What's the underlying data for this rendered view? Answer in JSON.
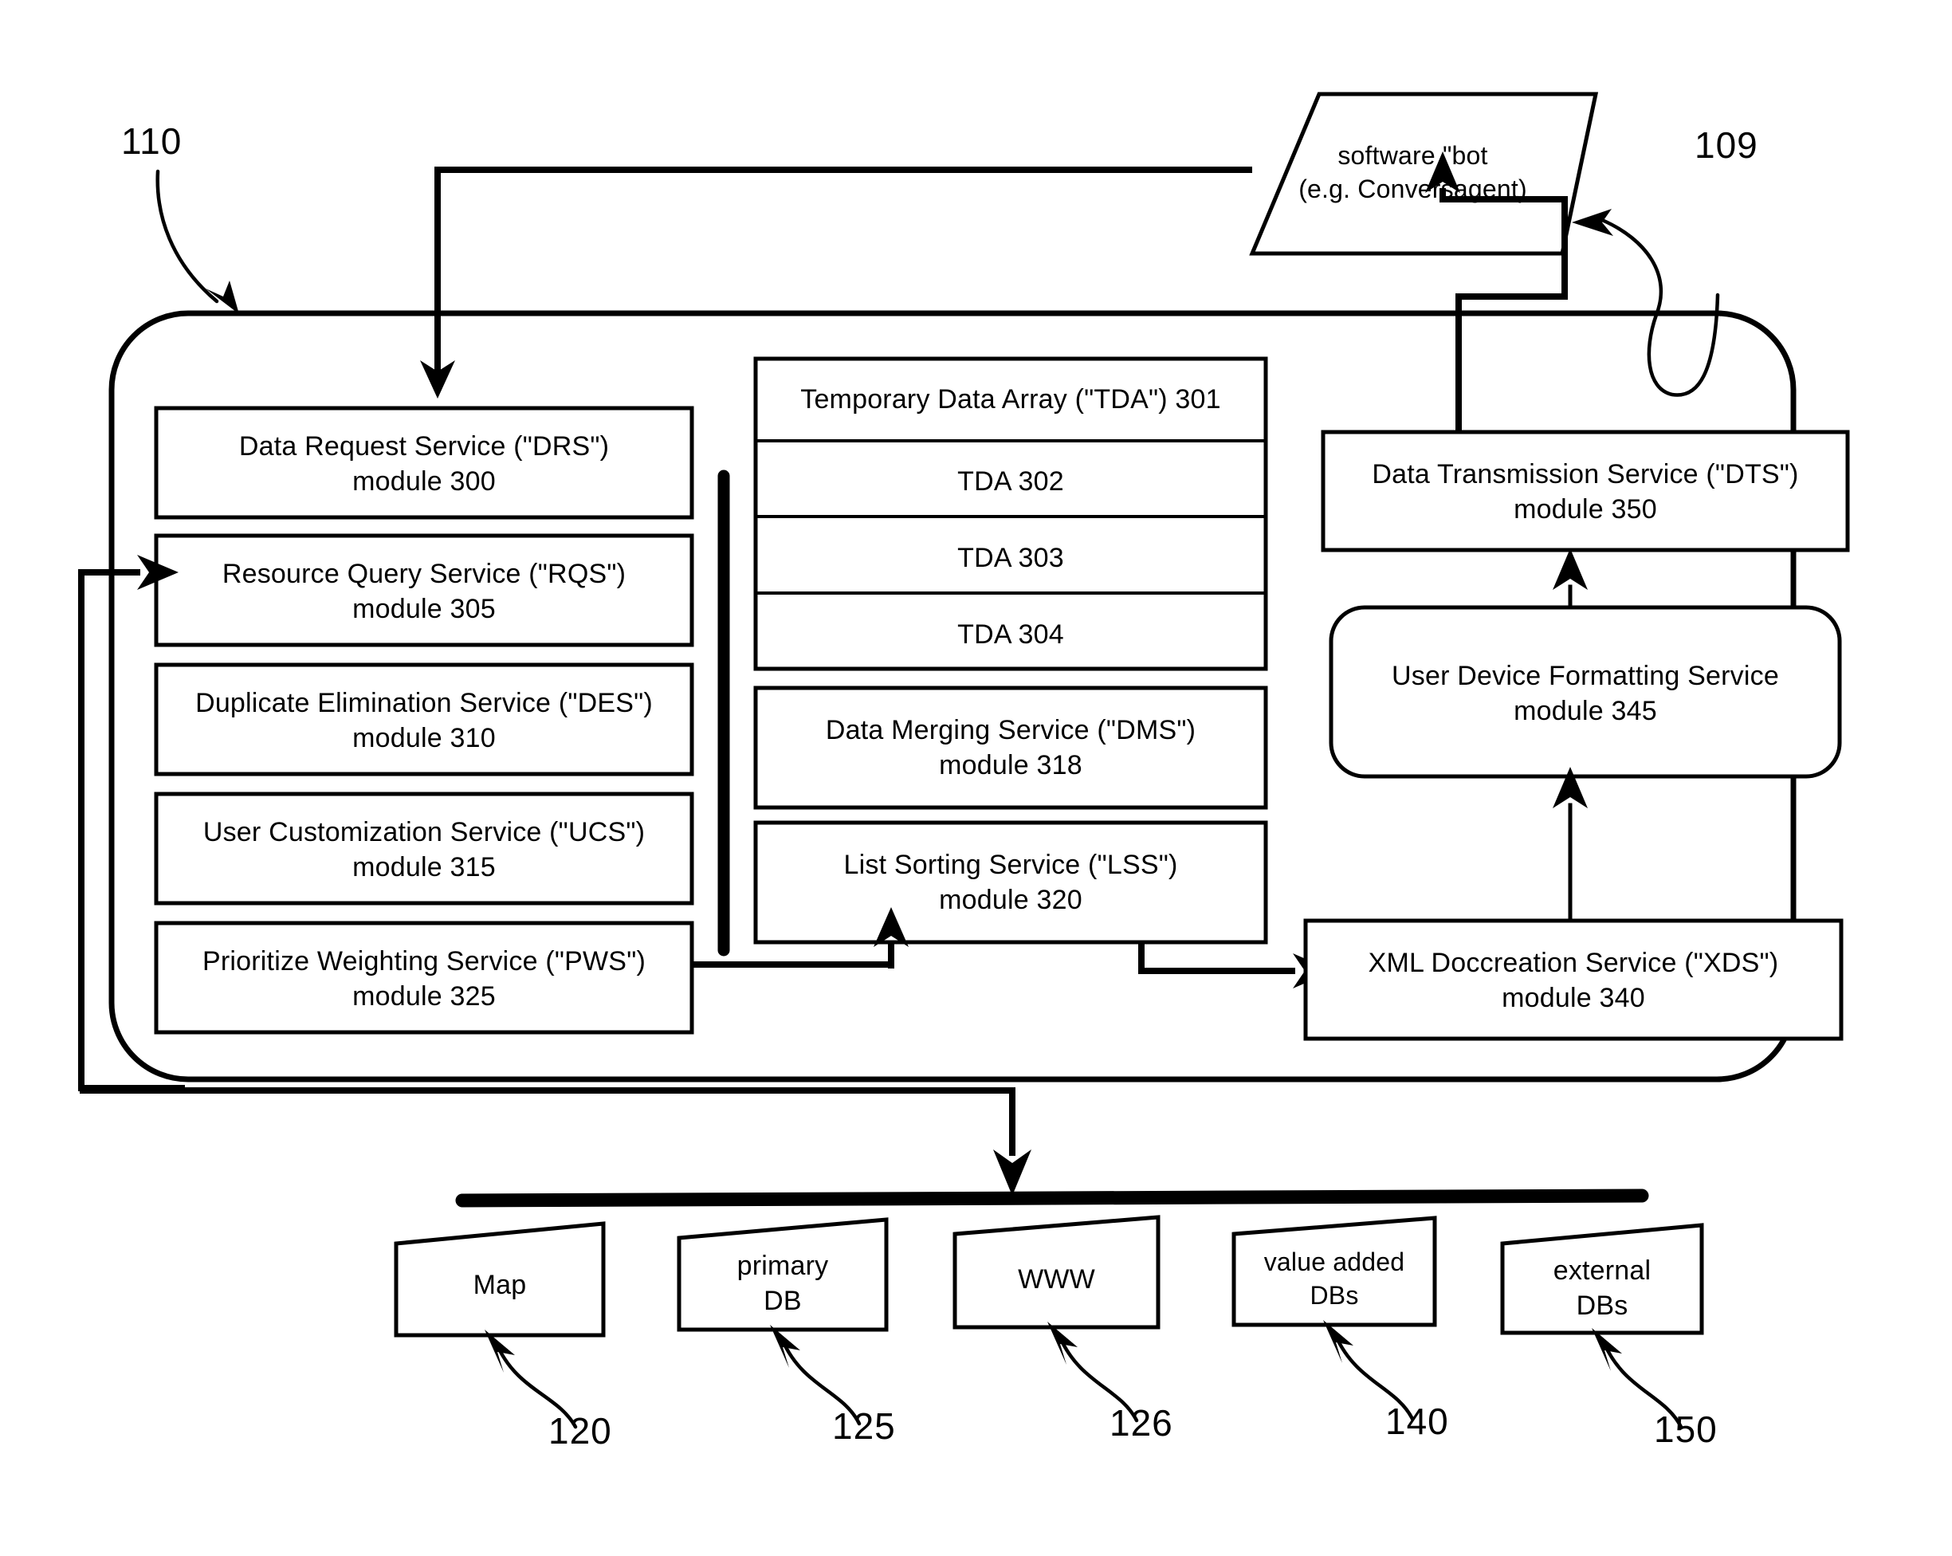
{
  "figure": {
    "type": "patent-block-diagram",
    "system_ref": "110",
    "bot_ref": "109"
  },
  "bot": {
    "line1": "software \"bot",
    "line2": "(e.g. Conversagent)",
    "ref": "109"
  },
  "system": {
    "ref": "110"
  },
  "left_column": [
    {
      "name": "Data Request Service (\"DRS\")",
      "module": "module 300"
    },
    {
      "name": "Resource Query Service (\"RQS\")",
      "module": "module 305"
    },
    {
      "name": "Duplicate Elimination Service (\"DES\")",
      "module": "module 310"
    },
    {
      "name": "User Customization Service (\"UCS\")",
      "module": "module 315"
    },
    {
      "name": "Prioritize Weighting Service (\"PWS\")",
      "module": "module 325"
    }
  ],
  "middle_column": {
    "tda_header": "Temporary Data Array (\"TDA\") 301",
    "tda_rows": [
      "TDA 302",
      "TDA 303",
      "TDA 304"
    ],
    "services": [
      {
        "name": "Data Merging Service (\"DMS\")",
        "module": "module 318"
      },
      {
        "name": "List Sorting Service (\"LSS\")",
        "module": "module 320"
      }
    ]
  },
  "right_column": [
    {
      "name": "Data Transmission Service (\"DTS\")",
      "module": "module 350"
    },
    {
      "name": "User Device Formatting Service",
      "module": "module 345"
    },
    {
      "name": "XML Doccreation Service (\"XDS\")",
      "module": "module 340"
    }
  ],
  "data_sources": [
    {
      "line1": "Map",
      "line2": "",
      "ref": "120"
    },
    {
      "line1": "primary",
      "line2": "DB",
      "ref": "125"
    },
    {
      "line1": "WWW",
      "line2": "",
      "ref": "126"
    },
    {
      "line1": "value added",
      "line2": "DBs",
      "ref": "140"
    },
    {
      "line1": "external",
      "line2": "DBs",
      "ref": "150"
    }
  ],
  "colors": {
    "ink": "#000000",
    "paper": "#ffffff"
  }
}
